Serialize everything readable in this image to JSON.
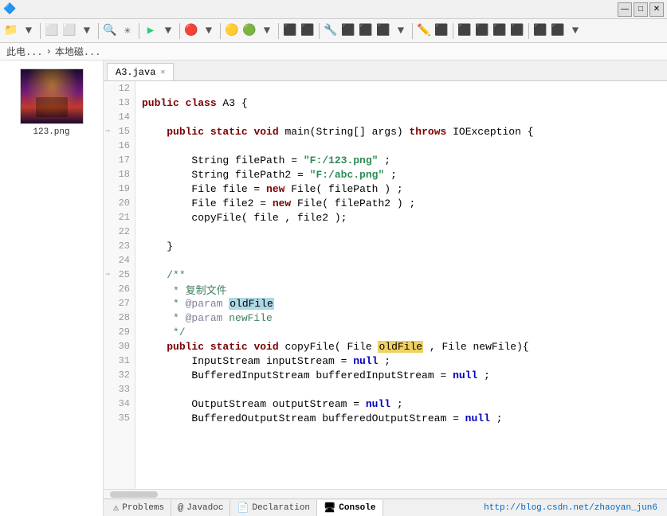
{
  "titlebar": {
    "minimize": "—",
    "maximize": "□",
    "close": "✕"
  },
  "breadcrumb": {
    "part1": "此电...",
    "sep1": "›",
    "part2": "本地磁..."
  },
  "tab": {
    "label": "A3.java",
    "close": "✕"
  },
  "sidebar": {
    "image_label": "123.png"
  },
  "code": {
    "lines": [
      {
        "num": 12,
        "content": "",
        "tokens": []
      },
      {
        "num": 13,
        "content": "public class A3 {",
        "tokens": [
          {
            "text": "public ",
            "cls": "kw"
          },
          {
            "text": "class ",
            "cls": "kw"
          },
          {
            "text": "A3 {",
            "cls": "normal"
          }
        ]
      },
      {
        "num": 14,
        "content": "",
        "tokens": []
      },
      {
        "num": 15,
        "content": "    public static void main(String[] args) throws IOException {",
        "arrow": true,
        "tokens": [
          {
            "text": "    ",
            "cls": "normal"
          },
          {
            "text": "public ",
            "cls": "kw"
          },
          {
            "text": "static ",
            "cls": "kw"
          },
          {
            "text": "void ",
            "cls": "kw"
          },
          {
            "text": "main(String[] args) ",
            "cls": "normal"
          },
          {
            "text": "throws ",
            "cls": "kw"
          },
          {
            "text": "IOException {",
            "cls": "normal"
          }
        ]
      },
      {
        "num": 16,
        "content": "",
        "tokens": []
      },
      {
        "num": 17,
        "content": "        String filePath = \"F:/123.png\" ;",
        "tokens": [
          {
            "text": "        String filePath = ",
            "cls": "normal"
          },
          {
            "text": "\"F:/123.png\"",
            "cls": "str"
          },
          {
            "text": " ;",
            "cls": "normal"
          }
        ]
      },
      {
        "num": 18,
        "content": "        String filePath2 = \"F:/abc.png\" ;",
        "tokens": [
          {
            "text": "        String filePath2 = ",
            "cls": "normal"
          },
          {
            "text": "\"F:/abc.png\"",
            "cls": "str"
          },
          {
            "text": " ;",
            "cls": "normal"
          }
        ]
      },
      {
        "num": 19,
        "content": "        File file = new File( filePath ) ;",
        "tokens": [
          {
            "text": "        File file = ",
            "cls": "normal"
          },
          {
            "text": "new ",
            "cls": "kw"
          },
          {
            "text": "File( filePath ) ;",
            "cls": "normal"
          }
        ]
      },
      {
        "num": 20,
        "content": "        File file2 = new File( filePath2 ) ;",
        "tokens": [
          {
            "text": "        File file2 = ",
            "cls": "normal"
          },
          {
            "text": "new ",
            "cls": "kw"
          },
          {
            "text": "File( filePath2 ) ;",
            "cls": "normal"
          }
        ]
      },
      {
        "num": 21,
        "content": "        copyFile( file , file2 );",
        "tokens": [
          {
            "text": "        copyFile( file , file2 );",
            "cls": "normal"
          }
        ]
      },
      {
        "num": 22,
        "content": "",
        "tokens": []
      },
      {
        "num": 23,
        "content": "    }",
        "tokens": [
          {
            "text": "    }",
            "cls": "normal"
          }
        ]
      },
      {
        "num": 24,
        "content": "",
        "tokens": []
      },
      {
        "num": 25,
        "content": "    /**",
        "arrow": true,
        "tokens": [
          {
            "text": "    ",
            "cls": "normal"
          },
          {
            "text": "/**",
            "cls": "comment"
          }
        ]
      },
      {
        "num": 26,
        "content": "     * 复制文件",
        "tokens": [
          {
            "text": "     * 复制文件",
            "cls": "comment"
          }
        ]
      },
      {
        "num": 27,
        "content": "     * @param oldFile",
        "tokens": [
          {
            "text": "     * ",
            "cls": "comment"
          },
          {
            "text": "@param ",
            "cls": "comment-tag"
          },
          {
            "text": "oldFile",
            "cls": "highlight-sel-text"
          }
        ]
      },
      {
        "num": 28,
        "content": "     * @param newFile",
        "tokens": [
          {
            "text": "     * ",
            "cls": "comment"
          },
          {
            "text": "@param ",
            "cls": "comment-tag"
          },
          {
            "text": "newFile",
            "cls": "comment"
          }
        ]
      },
      {
        "num": 29,
        "content": "     */",
        "tokens": [
          {
            "text": "     */",
            "cls": "comment"
          }
        ]
      },
      {
        "num": 30,
        "content": "    public static void copyFile( File oldFile , File newFile){",
        "tokens": [
          {
            "text": "    ",
            "cls": "normal"
          },
          {
            "text": "public ",
            "cls": "kw"
          },
          {
            "text": "static ",
            "cls": "kw"
          },
          {
            "text": "void ",
            "cls": "kw"
          },
          {
            "text": "copyFile( File ",
            "cls": "normal"
          },
          {
            "text": "oldFile",
            "cls": "highlight-bg-text"
          },
          {
            "text": " , File newFile){",
            "cls": "normal"
          }
        ]
      },
      {
        "num": 31,
        "content": "        InputStream inputStream = null ;",
        "tokens": [
          {
            "text": "        InputStream inputStream = ",
            "cls": "normal"
          },
          {
            "text": "null",
            "cls": "kw-blue"
          },
          {
            "text": " ;",
            "cls": "normal"
          }
        ]
      },
      {
        "num": 32,
        "content": "        BufferedInputStream bufferedInputStream = null ;",
        "tokens": [
          {
            "text": "        BufferedInputStream bufferedInputStream = ",
            "cls": "normal"
          },
          {
            "text": "null",
            "cls": "kw-blue"
          },
          {
            "text": " ;",
            "cls": "normal"
          }
        ]
      },
      {
        "num": 33,
        "content": "",
        "tokens": []
      },
      {
        "num": 34,
        "content": "        OutputStream outputStream = null ;",
        "tokens": [
          {
            "text": "        OutputStream outputStream = ",
            "cls": "normal"
          },
          {
            "text": "null",
            "cls": "kw-blue"
          },
          {
            "text": " ;",
            "cls": "normal"
          }
        ]
      },
      {
        "num": 35,
        "content": "        BufferedOutputStream bufferedOutputStream = null ;",
        "tokens": [
          {
            "text": "        BufferedOutputStream bufferedOutputStream = ",
            "cls": "normal"
          },
          {
            "text": "null",
            "cls": "kw-blue"
          },
          {
            "text": " ;",
            "cls": "normal"
          }
        ]
      }
    ]
  },
  "bottom_tabs": [
    {
      "label": "Problems",
      "icon": "⚠",
      "active": false
    },
    {
      "label": "Javadoc",
      "icon": "@",
      "active": false
    },
    {
      "label": "Declaration",
      "icon": "📄",
      "active": false
    },
    {
      "label": "Console",
      "icon": "🖥",
      "active": true
    }
  ],
  "status_url": "http://blog.csdn.net/zhaoyan_jun6"
}
